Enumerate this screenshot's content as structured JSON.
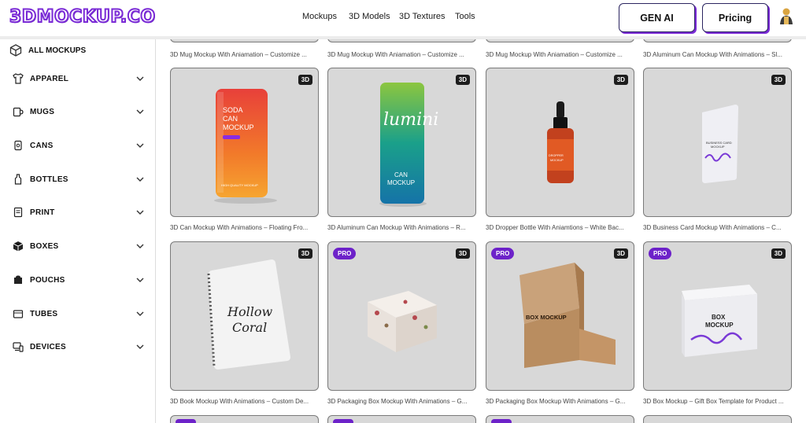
{
  "logo": "3DMOCKUP.CO",
  "nav": [
    "Mockups",
    "3D Models",
    "3D Textures",
    "Tools"
  ],
  "buttons": {
    "gen_ai": "GEN AI",
    "pricing": "Pricing"
  },
  "sidebar": {
    "all": "ALL MOCKUPS",
    "items": [
      {
        "label": "APPAREL",
        "icon": "shirt-icon"
      },
      {
        "label": "MUGS",
        "icon": "mug-icon"
      },
      {
        "label": "CANS",
        "icon": "can-icon"
      },
      {
        "label": "BOTTLES",
        "icon": "bottle-icon"
      },
      {
        "label": "PRINT",
        "icon": "print-icon"
      },
      {
        "label": "BOXES",
        "icon": "box-icon"
      },
      {
        "label": "POUCHS",
        "icon": "pouch-icon"
      },
      {
        "label": "TUBES",
        "icon": "tube-icon"
      },
      {
        "label": "DEVICES",
        "icon": "devices-icon"
      }
    ]
  },
  "top_captions": [
    "3D Mug Mockup With Aniamation – Customize ...",
    "3D Mug Mockup With Aniamation – Customize ...",
    "3D Mug Mockup With Aniamation – Customize ...",
    "3D Aluminum Can Mockup With Animations – Sl..."
  ],
  "cards": [
    {
      "caption": "3D Can Mockup With Animations – Floating Fro...",
      "badge": "3D",
      "pro": "",
      "art_text": [
        "SODA",
        "CAN",
        "MOCKUP",
        "HIGH QUALITY MOCKUP"
      ]
    },
    {
      "caption": "3D Aluminum Can Mockup With Animations – R...",
      "badge": "3D",
      "pro": "",
      "art_text": [
        "lumini",
        "CAN",
        "MOCKUP"
      ]
    },
    {
      "caption": "3D Dropper Bottle With Aniamtions – White Bac...",
      "badge": "3D",
      "pro": "",
      "art_text": [
        "DROPPER",
        "MOCKUP"
      ]
    },
    {
      "caption": "3D Business Card Mockup With Animations – C...",
      "badge": "3D",
      "pro": "",
      "art_text": [
        "BUSINESS CARD",
        "MOCKUP"
      ]
    },
    {
      "caption": "3D Book Mockup With Animations – Custom De...",
      "badge": "3D",
      "pro": "",
      "art_text": [
        "Hollow",
        "Coral"
      ]
    },
    {
      "caption": "3D Packaging Box Mockup With Animations – G...",
      "badge": "3D",
      "pro": "PRO",
      "art_text": []
    },
    {
      "caption": "3D Packaging Box Mockup With Animations – G...",
      "badge": "3D",
      "pro": "PRO",
      "art_text": [
        "BOX MOCKUP"
      ]
    },
    {
      "caption": "3D Box Mockup – Gift Box Template for Product ...",
      "badge": "3D",
      "pro": "PRO",
      "art_text": [
        "BOX",
        "MOCKUP"
      ]
    }
  ],
  "colors": {
    "brand": "#7a2ad6",
    "pro_badge": "#6d22c9",
    "card_bg": "#d8d8d8"
  }
}
